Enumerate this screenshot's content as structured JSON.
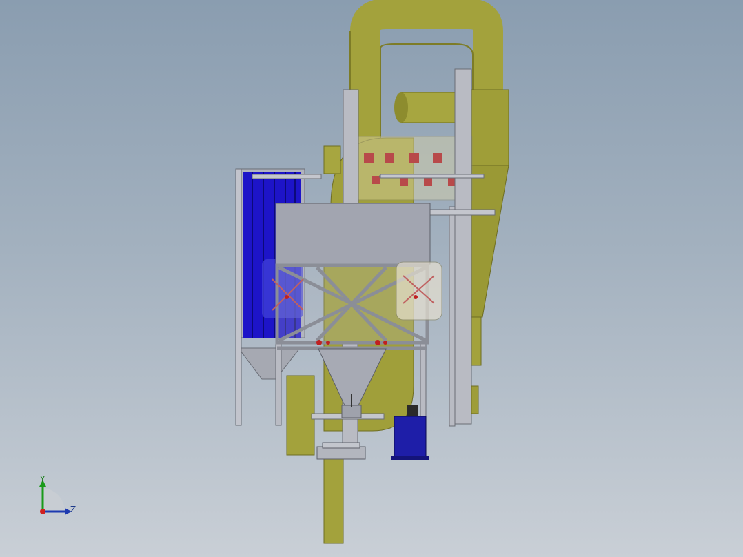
{
  "viewport": {
    "background_top": "#8a9db0",
    "background_bottom": "#c9cfd6"
  },
  "colors": {
    "duct_olive": "#a3a23c",
    "duct_olive_dark": "#7d7c27",
    "frame_gray": "#9c9fa8",
    "frame_light": "#b9bbc3",
    "filter_blue": "#1d14c8",
    "motor_blue": "#1e1ea8",
    "valve_red": "#b84a4a"
  },
  "axis_triad": {
    "y_label": "Y",
    "z_label": "Z",
    "y_icon": "green-arrow-icon",
    "z_icon": "blue-arrow-icon",
    "origin_icon": "red-dot-icon"
  }
}
